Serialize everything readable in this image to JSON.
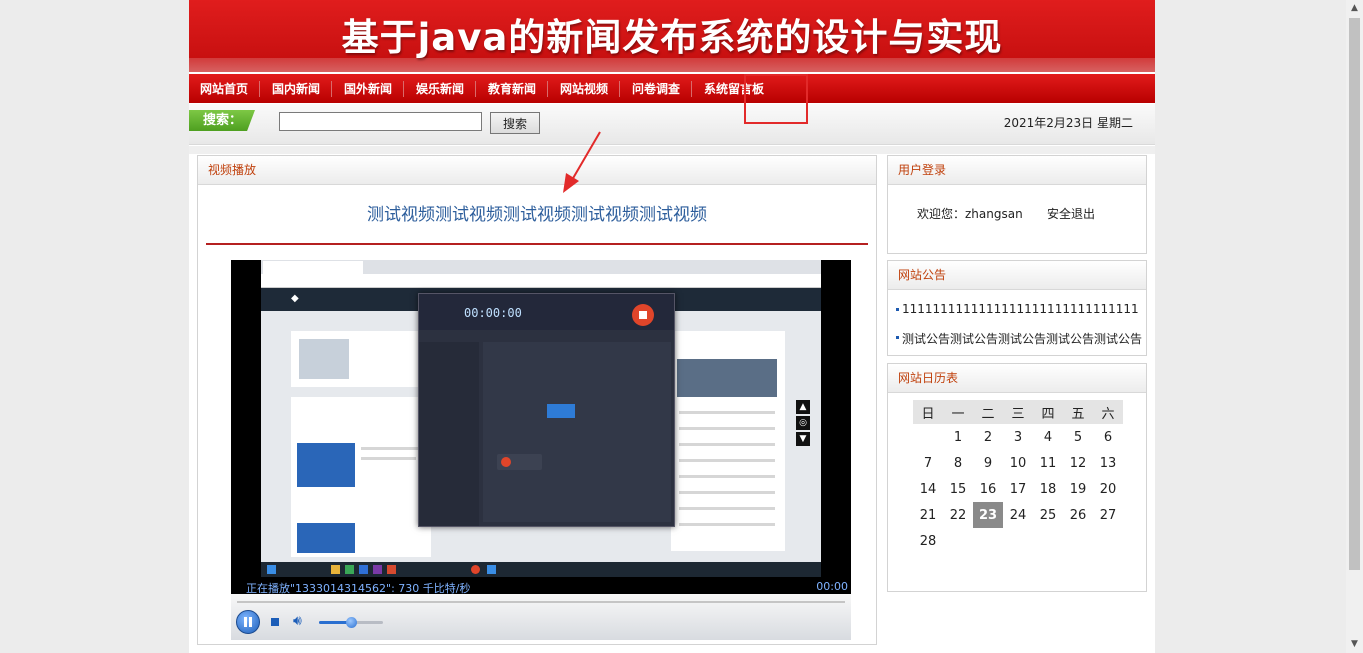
{
  "banner": {
    "title": "基于java的新闻发布系统的设计与实现"
  },
  "nav": {
    "items": [
      {
        "label": "网站首页",
        "name": "nav-home"
      },
      {
        "label": "国内新闻",
        "name": "nav-domestic-news"
      },
      {
        "label": "国外新闻",
        "name": "nav-foreign-news"
      },
      {
        "label": "娱乐新闻",
        "name": "nav-entertainment-news"
      },
      {
        "label": "教育新闻",
        "name": "nav-education-news"
      },
      {
        "label": "网站视频",
        "name": "nav-site-video"
      },
      {
        "label": "问卷调查",
        "name": "nav-survey"
      },
      {
        "label": "系统留言板",
        "name": "nav-message-board"
      }
    ],
    "active": "网站视频"
  },
  "search": {
    "label": "搜索：",
    "button": "搜索",
    "value": "",
    "placeholder": ""
  },
  "date": "2021年2月23日 星期二",
  "video": {
    "panel_title": "视频播放",
    "title": "测试视频测试视频测试视频测试视频测试视频",
    "status": "正在播放\"1333014314562\": 730 千比特/秒",
    "time": "00:00",
    "volume_level": 0.5
  },
  "login": {
    "title": "用户登录",
    "welcome": "欢迎您：zhangsan",
    "logout": "安全退出"
  },
  "notices": {
    "title": "网站公告",
    "items": [
      "1111111111111111111111111111111",
      "测试公告测试公告测试公告测试公告测试公告"
    ]
  },
  "calendar": {
    "title": "网站日历表",
    "weekdays": [
      "日",
      "一",
      "二",
      "三",
      "四",
      "五",
      "六"
    ],
    "weeks": [
      [
        "",
        "1",
        "2",
        "3",
        "4",
        "5",
        "6"
      ],
      [
        "7",
        "8",
        "9",
        "10",
        "11",
        "12",
        "13"
      ],
      [
        "14",
        "15",
        "16",
        "17",
        "18",
        "19",
        "20"
      ],
      [
        "21",
        "22",
        "23",
        "24",
        "25",
        "26",
        "27"
      ],
      [
        "28",
        "",
        "",
        "",
        "",
        "",
        ""
      ]
    ],
    "today": "23"
  }
}
